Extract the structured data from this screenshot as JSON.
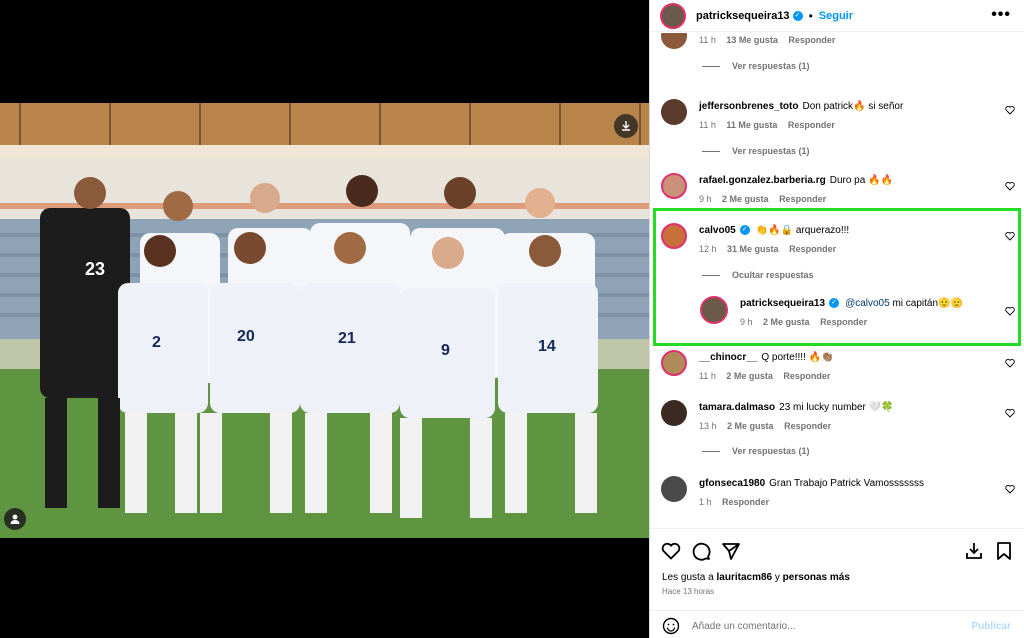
{
  "header": {
    "username": "patricksequeira13",
    "separator": "•",
    "follow_label": "Seguir",
    "more_label": "•••"
  },
  "comments": [
    {
      "user": "",
      "text": "",
      "time": "11 h",
      "likes": "13 Me gusta",
      "reply": "Responder",
      "view_replies": "Ver respuestas (1)"
    },
    {
      "user": "jeffersonbrenes_toto",
      "text": "Don patrick🔥 si señor",
      "time": "11 h",
      "likes": "11 Me gusta",
      "reply": "Responder",
      "view_replies": "Ver respuestas (1)"
    },
    {
      "user": "rafael.gonzalez.barberia.rg",
      "text": "Duro pa 🔥🔥",
      "time": "9 h",
      "likes": "2 Me gusta",
      "reply": "Responder"
    },
    {
      "user": "calvo05",
      "text": "👏🔥🔒 arquerazo!!!",
      "time": "12 h",
      "likes": "31 Me gusta",
      "reply": "Responder",
      "hide_replies": "Ocultar respuestas"
    },
    {
      "user": "patricksequeira13",
      "mention": "@calvo05",
      "text": "mi capitán🫡🫡",
      "time": "9 h",
      "likes": "2 Me gusta",
      "reply": "Responder"
    },
    {
      "user": "__chinocr__",
      "text": "Q porte!!!! 🔥👏🏽",
      "time": "11 h",
      "likes": "2 Me gusta",
      "reply": "Responder"
    },
    {
      "user": "tamara.dalmaso",
      "text": "23 mi lucky number 🤍🍀",
      "time": "13 h",
      "likes": "2 Me gusta",
      "reply": "Responder",
      "view_replies": "Ver respuestas (1)"
    },
    {
      "user": "gfonseca1980",
      "text": "Gran Trabajo Patrick Vamosssssss",
      "time": "1 h",
      "reply": "Responder"
    }
  ],
  "footer": {
    "likes_prefix": "Les gusta a",
    "likes_user": "lauritacm86",
    "likes_joiner": "y",
    "likes_others": "personas más",
    "time_ago": "Hace 13 horas",
    "add_comment_placeholder": "Añade un comentario...",
    "publish_label": "Publicar"
  },
  "colors": {
    "accent_blue": "#0095f6",
    "highlight_green": "#22dd22",
    "muted_text": "#737373"
  },
  "photo": {
    "jersey_numbers": [
      "23",
      "2",
      "20",
      "21",
      "9",
      "14"
    ]
  }
}
